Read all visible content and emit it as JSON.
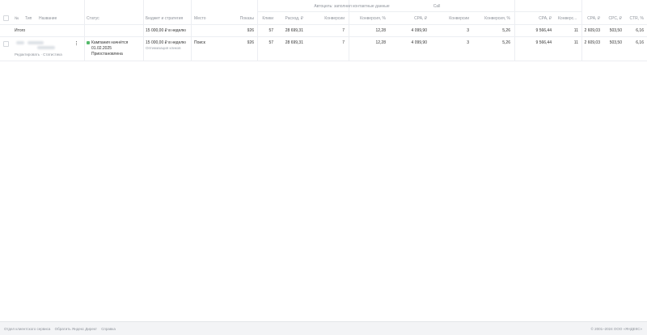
{
  "header": {
    "number": "№",
    "type": "Тип",
    "name": "Название",
    "status": "Статус",
    "budget": "Бюджет и стратегия",
    "place": "Место",
    "impressions": "Показы",
    "clicks": "Клики",
    "spend": "Расход, ₽",
    "goal1_group": "Автоцель: заполнил контактные данные",
    "goal2_group": "Call",
    "goal1_conversions": "Конверсии",
    "goal1_conv_rate": "Конверсия, %",
    "goal1_cpa": "CPA, ₽",
    "goal2_conversions": "Конверсии",
    "goal2_conv_rate": "Конверсия, %",
    "goal2_cpa": "CPA, ₽",
    "total_conversions": "Конверс...",
    "total_cpa": "CPA, ₽",
    "cpc": "CPC, ₽",
    "ctr": "CTR, %"
  },
  "total_row": {
    "label": "Итого",
    "budget": "15 000,00 ₽ в неделю",
    "impressions": "926",
    "clicks": "57",
    "spend": "28 699,31",
    "goal1_conversions": "7",
    "goal1_conv_rate": "12,28",
    "goal1_cpa": "4 099,90",
    "goal2_conversions": "3",
    "goal2_conv_rate": "5,26",
    "goal2_cpa": "9 566,44",
    "total_conversions": "11",
    "total_cpa": "2 609,03",
    "cpc": "503,50",
    "ctr": "6,16"
  },
  "campaign_row": {
    "actions": "Редактировать · Статистика",
    "status_line1": "Кампания начнётся",
    "status_line2": "01.02.2025",
    "status_line3": "Приостановлена",
    "budget": "15 000,00 ₽ в неделю",
    "strategy": "Оптимизация кликов",
    "place": "Поиск",
    "impressions": "926",
    "clicks": "57",
    "spend": "28 699,31",
    "goal1_conversions": "7",
    "goal1_conv_rate": "12,28",
    "goal1_cpa": "4 099,90",
    "goal2_conversions": "3",
    "goal2_conv_rate": "5,26",
    "goal2_cpa": "9 566,44",
    "total_conversions": "11",
    "total_cpa": "2 609,03",
    "cpc": "503,50",
    "ctr": "6,16"
  },
  "footer": {
    "links": [
      "Отдел клиентского сервиса",
      "Обратить Яндекс Директ",
      "Справка"
    ],
    "copyright": "© 2001–2024 ООО «ЯНДЕКС»"
  },
  "colors": {
    "status_ok": "#55b96b",
    "grid": "#eceef2"
  }
}
